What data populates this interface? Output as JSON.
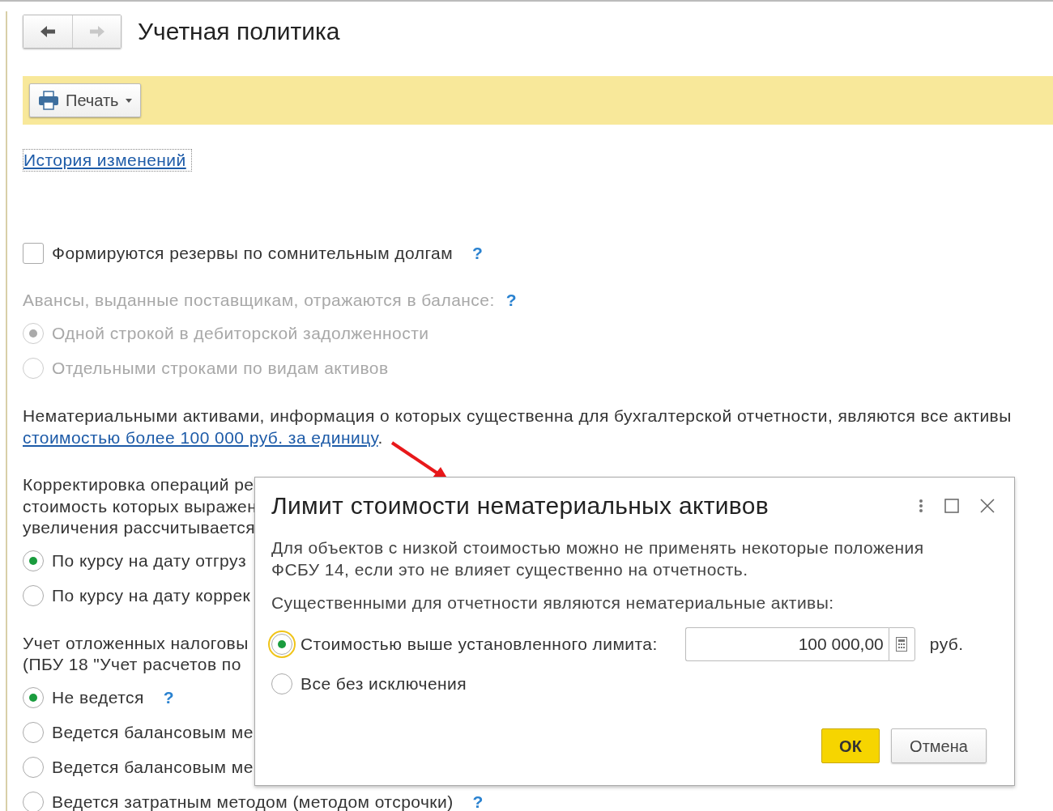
{
  "title": "Учетная политика",
  "nav": {
    "back": {
      "disabled": false
    },
    "forward": {
      "disabled": true
    }
  },
  "toolbar": {
    "print_button": "Печать"
  },
  "history_link": "История изменений",
  "sections": [
    {
      "kind": "checkbox",
      "label": "Формируются резервы по сомнительным долгам",
      "checked": false,
      "help": "?"
    },
    {
      "kind": "radio-group",
      "caption_lines": [
        "Авансы, выданные поставщикам, отражаются в балансе:"
      ],
      "help": "?",
      "disabled": true,
      "options": [
        {
          "label": "Одной строкой в дебиторской задолженности",
          "selected": true
        },
        {
          "label": "Отдельными строками по видам активов",
          "selected": false
        }
      ]
    },
    {
      "kind": "note",
      "text": "Нематериальными активами, информация о которых существенна для бухгалтерской отчетности, являются все активы",
      "link": "стоимостью более 100 000 руб. за единицу",
      "suffix": "."
    },
    {
      "kind": "radio-group",
      "caption_lines": [
        "Корректировка операций ре",
        "стоимость которых выражен",
        "увеличения рассчитывается"
      ],
      "disabled": false,
      "options": [
        {
          "label": "По курсу на дату отгруз",
          "selected": true
        },
        {
          "label": "По курсу на дату коррек",
          "selected": false
        }
      ]
    },
    {
      "kind": "radio-group",
      "caption_lines": [
        "Учет отложенных налоговы",
        "(ПБУ 18 \"Учет расчетов по"
      ],
      "disabled": false,
      "options": [
        {
          "label": "Не ведется",
          "selected": true,
          "help": "?"
        },
        {
          "label": "Ведется балансовым ме",
          "selected": false
        },
        {
          "label": "Ведется балансовым ме",
          "selected": false
        },
        {
          "label": "Ведется затратным методом (методом отсрочки)",
          "selected": false,
          "help": "?"
        }
      ]
    }
  ],
  "dialog": {
    "title": "Лимит стоимости нематериальных активов",
    "text_lines": [
      "Для объектов с низкой стоимостью можно не применять некоторые положения",
      "ФСБУ 14, если это не влияет существенно на отчетность."
    ],
    "prompt": "Существенными для отчетности являются нематериальные активы:",
    "options": [
      {
        "label": "Стоимостью выше установленного лимита:",
        "selected": true,
        "focused": true,
        "field": {
          "value": "100 000,00",
          "unit": "руб."
        }
      },
      {
        "label": "Все без исключения",
        "selected": false,
        "focused": false
      }
    ],
    "buttons": [
      {
        "label": "ОК",
        "kind": "primary"
      },
      {
        "label": "Отмена",
        "kind": "default"
      }
    ]
  }
}
